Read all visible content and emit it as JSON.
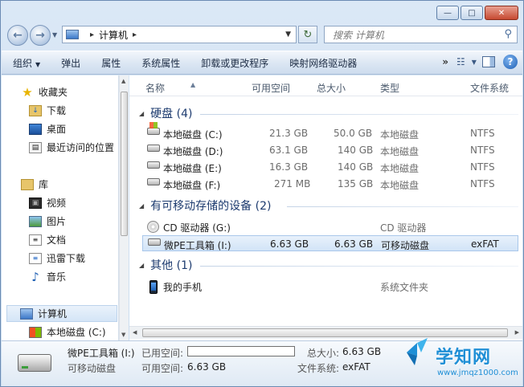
{
  "address": {
    "segment_1": "计算机",
    "search_placeholder": "搜索 计算机"
  },
  "toolbar": {
    "items": [
      "组织",
      "弹出",
      "属性",
      "系统属性",
      "卸载或更改程序",
      "映射网络驱动器"
    ],
    "more": "»"
  },
  "nav": {
    "favorites": "收藏夹",
    "downloads": "下载",
    "desktop": "桌面",
    "recent": "最近访问的位置",
    "libraries": "库",
    "videos": "视频",
    "pictures": "图片",
    "documents": "文档",
    "xunlei": "迅雷下载",
    "music": "音乐",
    "computer": "计算机",
    "local_c": "本地磁盘 (C:)"
  },
  "columns": {
    "name": "名称",
    "free": "可用空间",
    "total": "总大小",
    "type": "类型",
    "fs": "文件系统"
  },
  "groups": {
    "hdd": "硬盘 (4)",
    "removable": "有可移动存储的设备 (2)",
    "other": "其他 (1)"
  },
  "drives": [
    {
      "name": "本地磁盘 (C:)",
      "free": "21.3 GB",
      "total": "50.0 GB",
      "type": "本地磁盘",
      "fs": "NTFS"
    },
    {
      "name": "本地磁盘 (D:)",
      "free": "63.1 GB",
      "total": "140 GB",
      "type": "本地磁盘",
      "fs": "NTFS"
    },
    {
      "name": "本地磁盘 (E:)",
      "free": "16.3 GB",
      "total": "140 GB",
      "type": "本地磁盘",
      "fs": "NTFS"
    },
    {
      "name": "本地磁盘 (F:)",
      "free": "271 MB",
      "total": "135 GB",
      "type": "本地磁盘",
      "fs": "NTFS"
    }
  ],
  "removable": [
    {
      "name": "CD 驱动器 (G:)",
      "free": "",
      "total": "",
      "type": "CD 驱动器",
      "fs": ""
    },
    {
      "name": "微PE工具箱 (I:)",
      "free": "6.63 GB",
      "total": "6.63 GB",
      "type": "可移动磁盘",
      "fs": "exFAT"
    }
  ],
  "other": [
    {
      "name": "我的手机",
      "type": "系统文件夹"
    }
  ],
  "details": {
    "name": "微PE工具箱 (I:)",
    "kind": "可移动磁盘",
    "used_label": "已用空间:",
    "free_label": "可用空间:",
    "free_value": "6.63 GB",
    "total_label": "总大小:",
    "total_value": "6.63 GB",
    "fs_label": "文件系统:",
    "fs_value": "exFAT",
    "used_fraction": 0
  },
  "watermark": {
    "title": "学知网",
    "url": "www.jmqz1000.com"
  }
}
